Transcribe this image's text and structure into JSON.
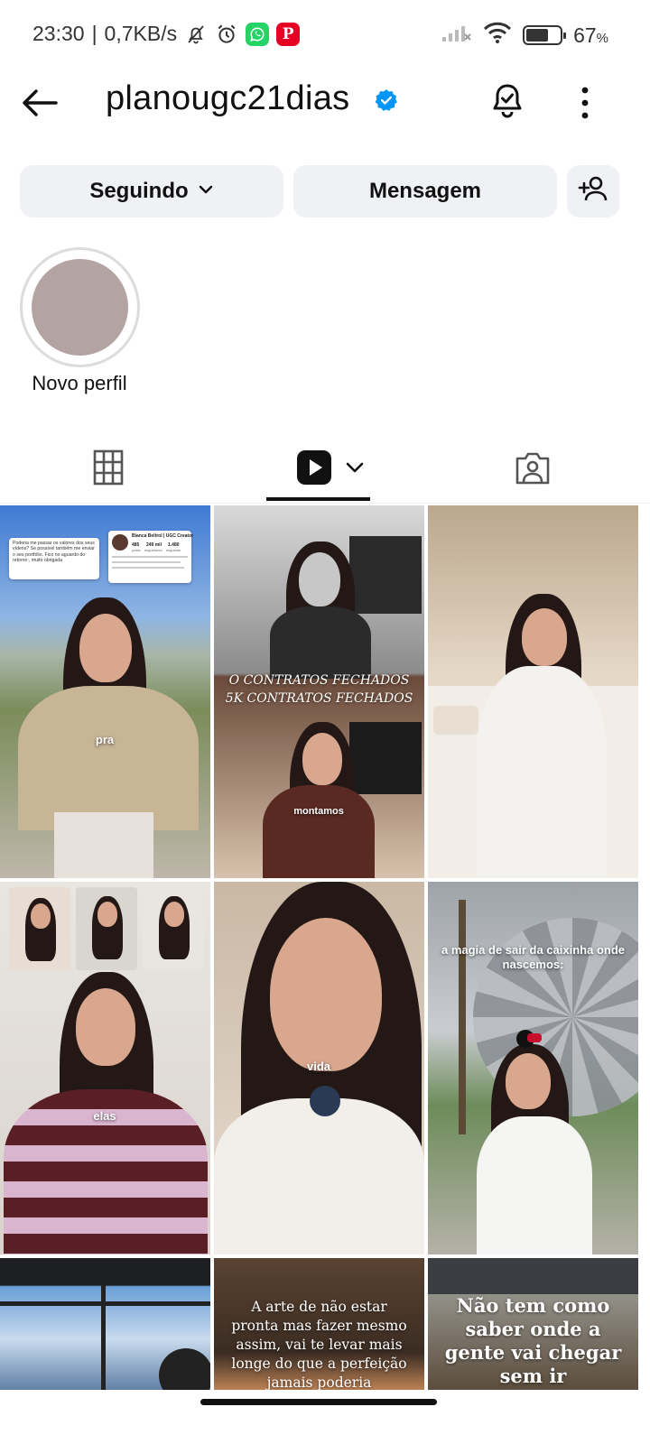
{
  "status_bar": {
    "time": "23:30",
    "speed": "0,7KB/s",
    "battery_percent": "67",
    "battery_symbol": "%",
    "battery_level": 0.67,
    "icons": [
      "bell-off-icon",
      "alarm-icon",
      "whatsapp-icon",
      "pinterest-icon",
      "signal-icon",
      "wifi-icon",
      "battery-icon"
    ]
  },
  "header": {
    "username": "planougc21dias",
    "verified": true,
    "icons": [
      "back-arrow-icon",
      "verified-badge-icon",
      "notification-bell-icon",
      "more-options-icon"
    ]
  },
  "actions": {
    "follow_label": "Seguindo",
    "message_label": "Mensagem",
    "icons": [
      "chevron-down-icon",
      "add-person-icon"
    ]
  },
  "highlights": [
    {
      "label": "Novo perfil"
    }
  ],
  "tabs": {
    "active": "reels",
    "items": [
      "grid-icon",
      "reels-icon",
      "tagged-icon"
    ]
  },
  "grid": {
    "tiles": [
      {
        "caption": "pra",
        "dm_text": "Poderia me passar os valores dos seus vídeos? Se possível também me enviar o seu portfólio. Fico no aguardo do retorno , muito obrigada",
        "profile_name": "Bianca Beltrol | UGC Creator",
        "stats": [
          "485",
          "249 mil",
          "1.480"
        ],
        "stats_labels": [
          "posts",
          "seguidores",
          "seguindo"
        ]
      },
      {
        "caption_top": "O CONTRATOS FECHADOS",
        "caption_bottom": "5K CONTRATOS FECHADOS",
        "caption": "montamos"
      },
      {
        "caption": ""
      },
      {
        "caption": "elas"
      },
      {
        "caption": "vida"
      },
      {
        "caption": "a magia de sair da caixinha onde nascemos:"
      },
      {
        "caption": ""
      },
      {
        "caption": "A arte de não estar pronta mas fazer mesmo assim, vai te levar mais longe do que a perfeição  jamais poderia"
      },
      {
        "caption": "Não tem como saber onde a gente vai chegar sem ir"
      }
    ]
  },
  "colors": {
    "button_bg": "#eff1f4",
    "verified": "#0095f6",
    "highlight_fill": "#b3a3a2",
    "text": "#111111"
  }
}
